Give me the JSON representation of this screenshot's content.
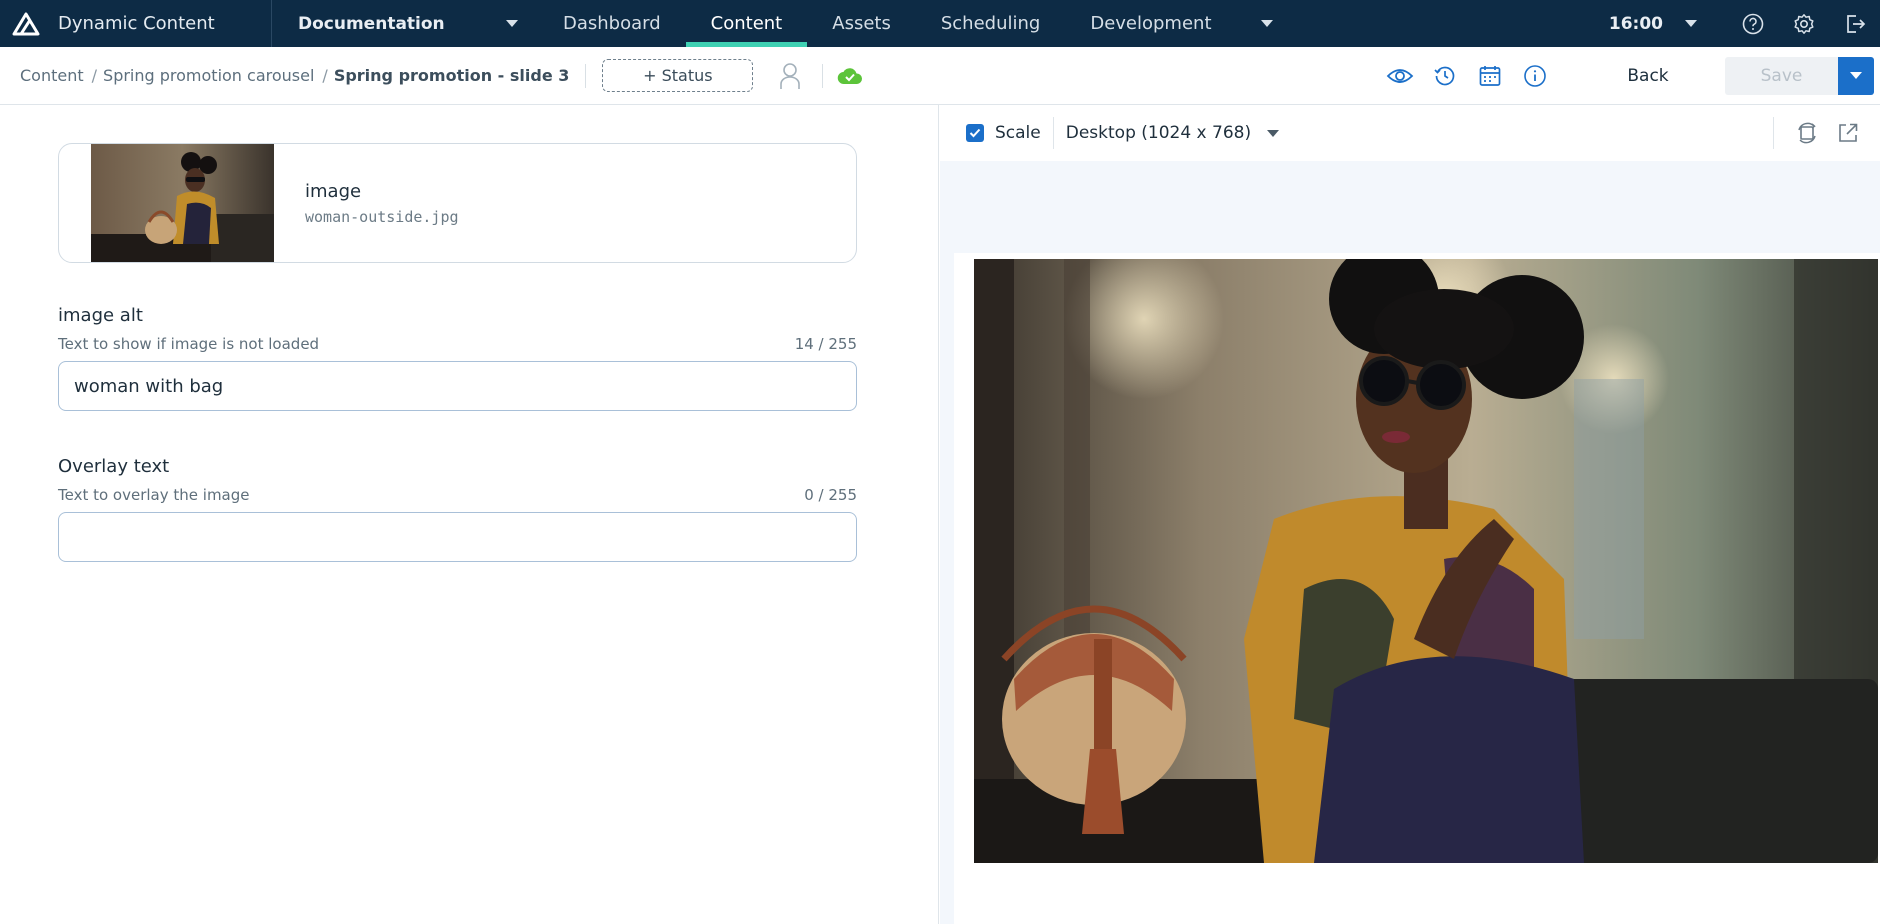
{
  "topbar": {
    "app_name": "Dynamic Content",
    "hub": "Documentation",
    "tabs": [
      {
        "label": "Dashboard",
        "active": false
      },
      {
        "label": "Content",
        "active": true
      },
      {
        "label": "Assets",
        "active": false
      },
      {
        "label": "Scheduling",
        "active": false
      },
      {
        "label": "Development",
        "active": false
      }
    ],
    "time": "16:00",
    "icons": [
      "help-icon",
      "settings-icon",
      "logout-icon"
    ]
  },
  "toolbar": {
    "breadcrumbs": [
      "Content",
      "Spring promotion carousel",
      "Spring promotion - slide 3"
    ],
    "status_label": "+ Status",
    "back_label": "Back",
    "save_label": "Save",
    "icons": [
      "assignee-icon",
      "cloud-check-icon",
      "eye-icon",
      "history-icon",
      "calendar-icon",
      "info-icon"
    ],
    "accent": "#1b6fc9",
    "cloud_color": "#5cc43a"
  },
  "form": {
    "image_card": {
      "title": "image",
      "filename": "woman-outside.jpg"
    },
    "image_alt": {
      "label": "image alt",
      "help": "Text to show if image is not loaded",
      "count": "14 / 255",
      "value": "woman with bag"
    },
    "overlay_text": {
      "label": "Overlay text",
      "help": "Text to overlay the image",
      "count": "0 / 255",
      "value": ""
    }
  },
  "preview": {
    "scale_label": "Scale",
    "scale_checked": true,
    "device": "Desktop (1024 x 768)",
    "icons": [
      "rotate-icon",
      "open-external-icon"
    ]
  }
}
